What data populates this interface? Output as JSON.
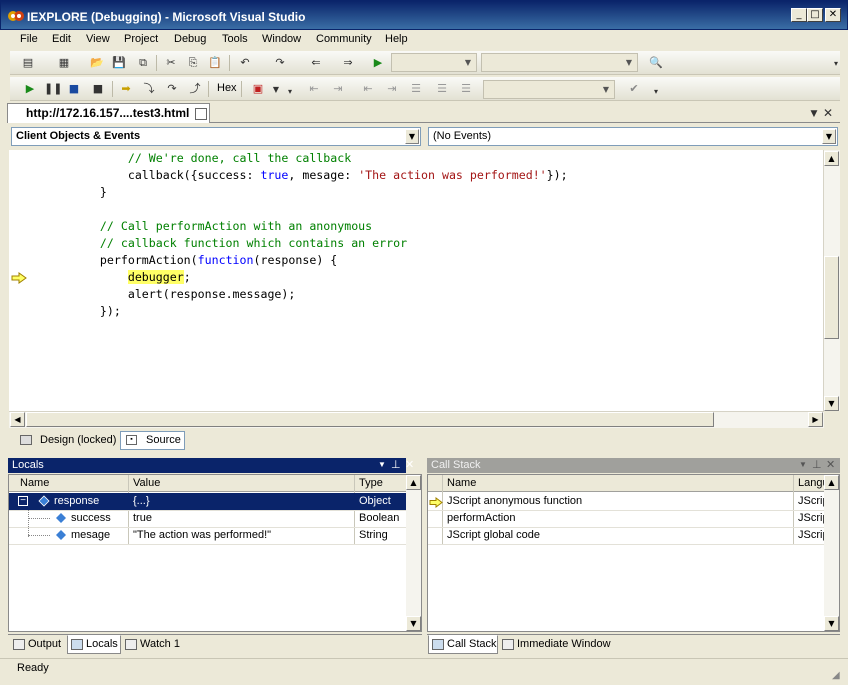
{
  "window": {
    "title": "IEXPLORE (Debugging) - Microsoft Visual Studio"
  },
  "menu": [
    "File",
    "Edit",
    "View",
    "Project",
    "Debug",
    "Tools",
    "Window",
    "Community",
    "Help"
  ],
  "toolbar": {
    "hex_label": "Hex"
  },
  "document_tab": {
    "label": "http://172.16.157....test3.html"
  },
  "navigation": {
    "objects": "Client Objects & Events",
    "events": "(No Events)"
  },
  "code_lines": [
    {
      "indent": "        ",
      "parts": [
        {
          "t": "// We're done, call the callback",
          "c": "cm"
        }
      ]
    },
    {
      "indent": "        ",
      "parts": [
        {
          "t": "callback({success: ",
          "c": ""
        },
        {
          "t": "true",
          "c": "kw"
        },
        {
          "t": ", mesage: ",
          "c": ""
        },
        {
          "t": "'The action was performed!'",
          "c": "st"
        },
        {
          "t": "});",
          "c": ""
        }
      ]
    },
    {
      "indent": "    ",
      "parts": [
        {
          "t": "}",
          "c": ""
        }
      ]
    },
    {
      "indent": "",
      "parts": []
    },
    {
      "indent": "    ",
      "parts": [
        {
          "t": "// Call performAction with an anonymous",
          "c": "cm"
        }
      ]
    },
    {
      "indent": "    ",
      "parts": [
        {
          "t": "// callback function which contains an error",
          "c": "cm"
        }
      ]
    },
    {
      "indent": "    ",
      "parts": [
        {
          "t": "performAction(",
          "c": ""
        },
        {
          "t": "function",
          "c": "kw"
        },
        {
          "t": "(response) {",
          "c": ""
        }
      ]
    },
    {
      "indent": "        ",
      "parts": [
        {
          "t": "debugger",
          "c": "dbg"
        },
        {
          "t": ";",
          "c": ""
        }
      ]
    },
    {
      "indent": "        ",
      "parts": [
        {
          "t": "alert(response.message);",
          "c": ""
        }
      ]
    },
    {
      "indent": "    ",
      "parts": [
        {
          "t": "});",
          "c": ""
        }
      ]
    }
  ],
  "view_tabs": {
    "design": "Design (locked)",
    "source": "Source"
  },
  "locals": {
    "title": "Locals",
    "columns": [
      "Name",
      "Value",
      "Type"
    ],
    "rows": [
      {
        "name": "response",
        "value": "{...}",
        "type": "Object",
        "expander": "⊟"
      },
      {
        "name": "success",
        "value": "true",
        "type": "Boolean"
      },
      {
        "name": "mesage",
        "value": "\"The action was performed!\"",
        "type": "String"
      }
    ]
  },
  "callstack": {
    "title": "Call Stack",
    "columns": [
      "Name",
      "Langu"
    ],
    "rows": [
      {
        "name": "JScript anonymous function",
        "lang": "JScrip"
      },
      {
        "name": "performAction",
        "lang": "JScrip"
      },
      {
        "name": "JScript global code",
        "lang": "JScrip"
      }
    ]
  },
  "bottom_tabs_left": [
    "Output",
    "Locals",
    "Watch 1"
  ],
  "bottom_tabs_right": [
    "Call Stack",
    "Immediate Window"
  ],
  "status": {
    "text": "Ready"
  },
  "colors": {
    "title_gradient_start": "#0a246a",
    "accent": "#0a246a",
    "keyword": "#0000ff",
    "comment": "#008000",
    "string": "#a31515",
    "debug_highlight": "#ffff66"
  }
}
